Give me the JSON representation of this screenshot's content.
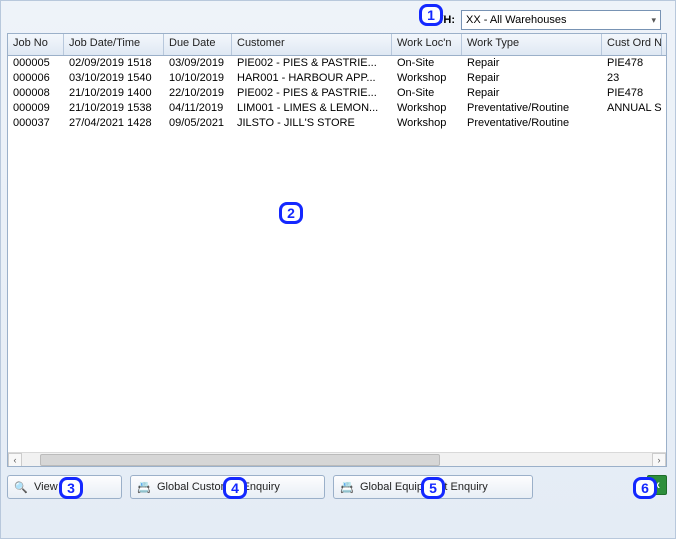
{
  "topbar": {
    "wh_label": "W/H:",
    "wh_selected": "XX - All Warehouses"
  },
  "columns": [
    "Job No",
    "Job Date/Time",
    "Due Date",
    "Customer",
    "Work Loc'n",
    "Work Type",
    "Cust Ord No"
  ],
  "rows": [
    {
      "job_no": "000005",
      "job_dt": "02/09/2019 1518",
      "due": "03/09/2019",
      "cust": "PIE002 - PIES & PASTRIE...",
      "loc": "On-Site",
      "wtype": "Repair",
      "ord": "PIE478"
    },
    {
      "job_no": "000006",
      "job_dt": "03/10/2019 1540",
      "due": "10/10/2019",
      "cust": "HAR001 - HARBOUR APP...",
      "loc": "Workshop",
      "wtype": "Repair",
      "ord": "23"
    },
    {
      "job_no": "000008",
      "job_dt": "21/10/2019 1400",
      "due": "22/10/2019",
      "cust": "PIE002 - PIES & PASTRIE...",
      "loc": "On-Site",
      "wtype": "Repair",
      "ord": "PIE478"
    },
    {
      "job_no": "000009",
      "job_dt": "21/10/2019 1538",
      "due": "04/11/2019",
      "cust": "LIM001 - LIMES & LEMON...",
      "loc": "Workshop",
      "wtype": "Preventative/Routine",
      "ord": "ANNUAL S..."
    },
    {
      "job_no": "000037",
      "job_dt": "27/04/2021 1428",
      "due": "09/05/2021",
      "cust": "JILSTO - JILL'S STORE",
      "loc": "Workshop",
      "wtype": "Preventative/Routine",
      "ord": ""
    }
  ],
  "buttons": {
    "view_job": "View Job",
    "global_customer": "Global Customer Enquiry",
    "global_equipment": "Global Equipment Enquiry"
  },
  "markers": {
    "m1": "1",
    "m2": "2",
    "m3": "3",
    "m4": "4",
    "m5": "5",
    "m6": "6"
  }
}
